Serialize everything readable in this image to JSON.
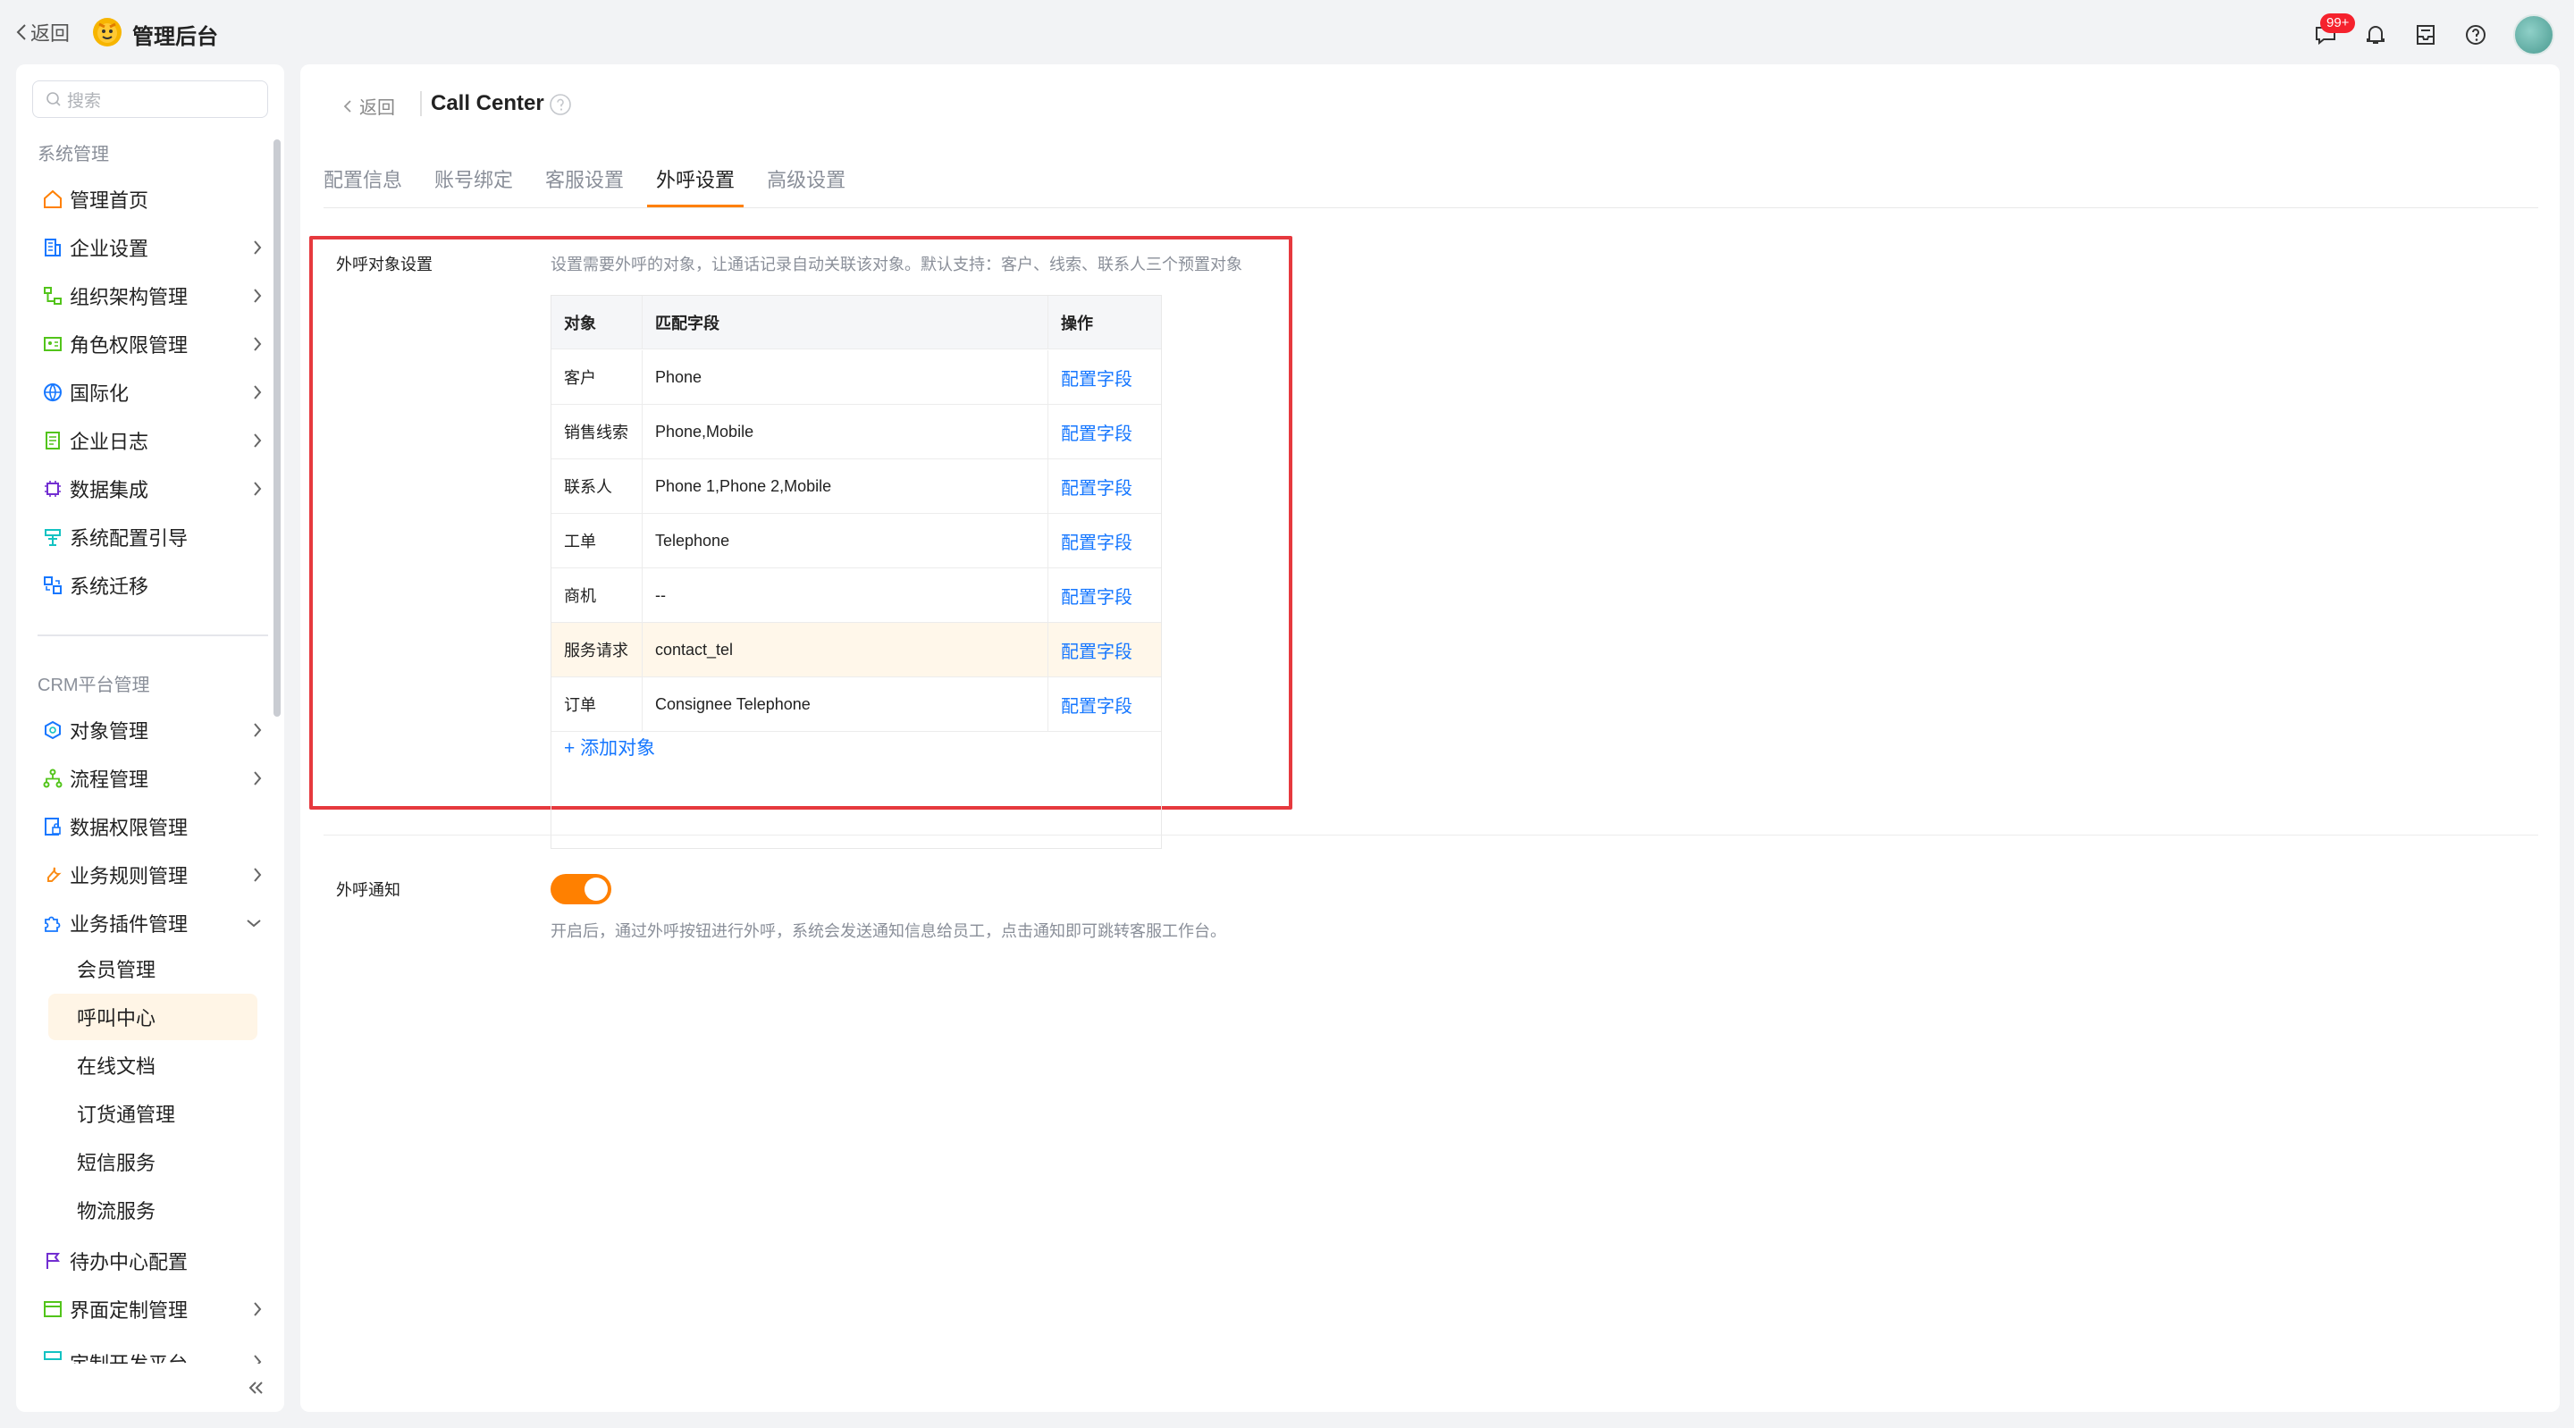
{
  "topbar": {
    "back_label": "返回",
    "app_title": "管理后台",
    "notification_badge": "99+",
    "icons": [
      "message-icon",
      "bell-icon",
      "inbox-icon",
      "help-icon",
      "user-avatar"
    ]
  },
  "sidebar": {
    "search_placeholder": "搜索",
    "group1_title": "系统管理",
    "group1_items": [
      {
        "label": "管理首页",
        "icon": "home-icon",
        "expandable": false
      },
      {
        "label": "企业设置",
        "icon": "building-icon",
        "expandable": true
      },
      {
        "label": "组织架构管理",
        "icon": "org-tree-icon",
        "expandable": true
      },
      {
        "label": "角色权限管理",
        "icon": "id-card-icon",
        "expandable": true
      },
      {
        "label": "国际化",
        "icon": "globe-icon",
        "expandable": true
      },
      {
        "label": "企业日志",
        "icon": "log-icon",
        "expandable": true
      },
      {
        "label": "数据集成",
        "icon": "chip-icon",
        "expandable": true
      },
      {
        "label": "系统配置引导",
        "icon": "signpost-icon",
        "expandable": false
      },
      {
        "label": "系统迁移",
        "icon": "migrate-icon",
        "expandable": false
      }
    ],
    "group2_title": "CRM平台管理",
    "group2_items": [
      {
        "label": "对象管理",
        "icon": "object-icon",
        "expandable": true
      },
      {
        "label": "流程管理",
        "icon": "flow-icon",
        "expandable": true
      },
      {
        "label": "数据权限管理",
        "icon": "data-lock-icon",
        "expandable": false
      },
      {
        "label": "业务规则管理",
        "icon": "tool-icon",
        "expandable": true
      },
      {
        "label": "业务插件管理",
        "icon": "puzzle-icon",
        "expandable": true,
        "expanded": true
      }
    ],
    "plugin_sub_items": [
      {
        "label": "会员管理",
        "active": false
      },
      {
        "label": "呼叫中心",
        "active": true
      },
      {
        "label": "在线文档",
        "active": false
      },
      {
        "label": "订货通管理",
        "active": false
      },
      {
        "label": "短信服务",
        "active": false
      },
      {
        "label": "物流服务",
        "active": false
      }
    ],
    "group3_items": [
      {
        "label": "待办中心配置",
        "icon": "flag-icon",
        "expandable": false
      },
      {
        "label": "界面定制管理",
        "icon": "layout-icon",
        "expandable": true
      },
      {
        "label": "定制开发平台",
        "icon": "dev-icon",
        "expandable": true
      }
    ]
  },
  "main": {
    "back_label": "返回",
    "title": "Call Center",
    "tabs": [
      {
        "label": "配置信息",
        "active": false
      },
      {
        "label": "账号绑定",
        "active": false
      },
      {
        "label": "客服设置",
        "active": false
      },
      {
        "label": "外呼设置",
        "active": true
      },
      {
        "label": "高级设置",
        "active": false
      }
    ],
    "outbound_object": {
      "label": "外呼对象设置",
      "description": "设置需要外呼的对象，让通话记录自动关联该对象。默认支持：客户、线索、联系人三个预置对象",
      "columns": [
        "对象",
        "匹配字段",
        "操作"
      ],
      "rows": [
        {
          "object": "客户",
          "field": "Phone",
          "action": "配置字段"
        },
        {
          "object": "销售线索",
          "field": "Phone,Mobile",
          "action": "配置字段"
        },
        {
          "object": "联系人",
          "field": "Phone 1,Phone 2,Mobile",
          "action": "配置字段"
        },
        {
          "object": "工单",
          "field": "Telephone",
          "action": "配置字段"
        },
        {
          "object": "商机",
          "field": "--",
          "action": "配置字段"
        },
        {
          "object": "服务请求",
          "field": "contact_tel",
          "action": "配置字段"
        },
        {
          "object": "订单",
          "field": "Consignee Telephone",
          "action": "配置字段"
        }
      ],
      "add_label": "+ 添加对象"
    },
    "outbound_notify": {
      "label": "外呼通知",
      "enabled": true,
      "description": "开启后，通过外呼按钮进行外呼，系统会发送通知信息给员工，点击通知即可跳转客服工作台。"
    }
  },
  "colors": {
    "accent": "#ff8000",
    "link": "#1677ff",
    "highlight": "#e6393e"
  }
}
